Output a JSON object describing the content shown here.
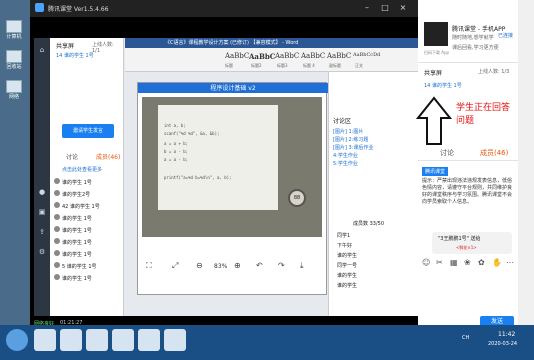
{
  "desktop": {
    "icons": [
      {
        "label": "计算机"
      },
      {
        "label": "回收站"
      },
      {
        "label": "网络"
      }
    ]
  },
  "main_window": {
    "title": "腾讯课堂 Ver1.5.4.66",
    "status": "网络良好",
    "timer": "01:21:27"
  },
  "classroom_left": {
    "header": "共享屏",
    "online": "上线人数: 1/1",
    "member": "14 谁的学生 1号",
    "share_button": "邀请学生发言",
    "tabs": [
      "讨论",
      "成员(46)"
    ],
    "list_title": "点击此处查看更多",
    "members": [
      "谁的学生 1号",
      "谁的学生2号",
      "42 谁的学生 1号",
      "谁的学生 1号",
      "谁的学生 1号",
      "谁的学生 1号",
      "谁的学生 1号",
      "5 谁的学生 1号",
      "谁的学生 1号"
    ]
  },
  "doc_window": {
    "title": "《C语言》课程教学设计方案 (已修订) 【兼容模式】 - Word",
    "ribbon_styles": [
      "AaBbC",
      "AaBbC",
      "AaBbC",
      "AaBbC",
      "AaBbC",
      "AaBbCcDd"
    ],
    "ribbon_style_labels": [
      "标题",
      "标题2",
      "标题3",
      "标题 4",
      "副标题",
      "正文"
    ]
  },
  "video_window": {
    "title": "程序设计基础 v2",
    "code_lines": [
      "int a, b;",
      "scanf(\"%d %d\", &a, &b);",
      "a = a + b;",
      "b = a - b;",
      "a = a - b;",
      "",
      "printf(\"a=%d b=%d\\n\", a, b);"
    ],
    "zoom": "83%",
    "dial_label": "88"
  },
  "chat_panel": {
    "header": "讨论区",
    "lines": [
      "[图片] 1:图片",
      "[图片] 2:练习题",
      "[图片] 3:课后作业",
      "4:学生作业",
      "5:学生作业"
    ],
    "member_count": "成员数 33/50",
    "names": [
      "同学1",
      "下午好",
      "谁的学生",
      "同学一号",
      "谁的学生",
      "谁的学生"
    ]
  },
  "right_panel": {
    "app_title": "腾讯课堂 - 手机APP",
    "app_sub": "随时随地,想学就学",
    "app_sub2": "课后回看,学习更方便",
    "qr_note": "扫码下载 App",
    "badge": "已连接",
    "header": "共享屏",
    "online": "上线人数: 1/3",
    "student": "14 谁的学生 1号",
    "annotation": "学生正在回答问题",
    "tabs": [
      "讨论",
      "成员(46)"
    ],
    "notice_title": "腾讯课堂",
    "notice_body": "提示：严禁出现违法违规发表信息，低俗色情内容，请遵守平台规则，共同维护良好的课堂秩序与学习氛围。腾讯课堂不会向学员索取个人信息。",
    "bubble_text": "\"3王鹏鹏1号\" 送给",
    "bubble_sub": "<鲜花×1>",
    "send_label": "发送",
    "input_placeholder": "说点什么吧..."
  },
  "taskbar": {
    "time": "11:42",
    "date": "2020-03-24",
    "lang": "CH"
  }
}
